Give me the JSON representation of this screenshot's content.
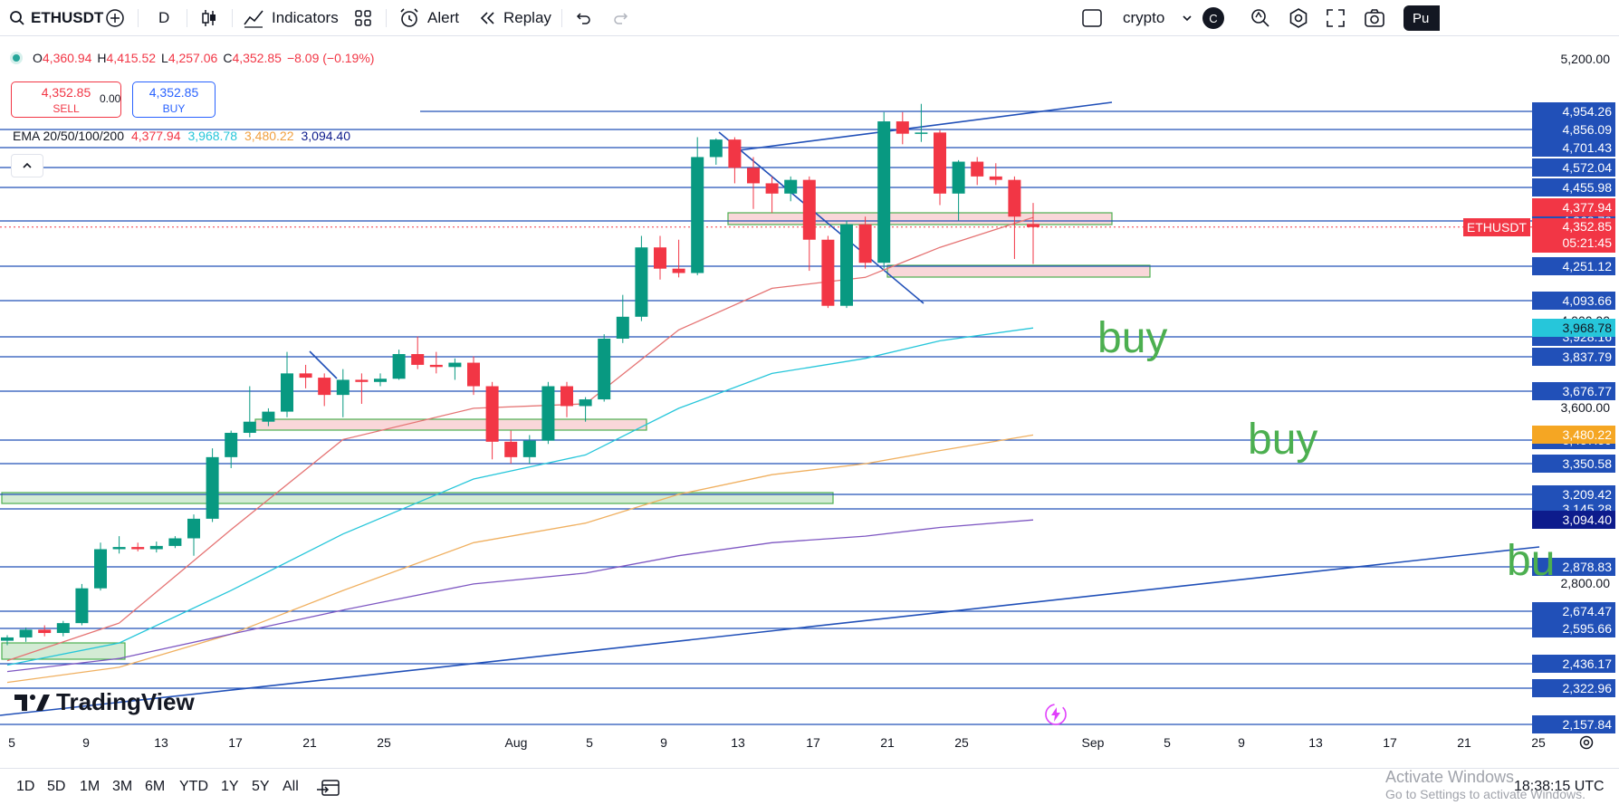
{
  "toolbar": {
    "symbol": "ETHUSDT",
    "interval": "D",
    "indicators_label": "Indicators",
    "alert_label": "Alert",
    "replay_label": "Replay",
    "layout_name": "crypto",
    "avatar_letter": "C",
    "publish_label": "Pu"
  },
  "legend": {
    "open_label": "O",
    "open": "4,360.94",
    "high_label": "H",
    "high": "4,415.52",
    "low_label": "L",
    "low": "4,257.06",
    "close_label": "C",
    "close": "4,352.85",
    "change": "−8.09 (−0.19%)"
  },
  "trade": {
    "sell_price": "4,352.85",
    "sell_label": "SELL",
    "spread": "0.00",
    "buy_price": "4,352.85",
    "buy_label": "BUY"
  },
  "ema": {
    "title": "EMA 20/50/100/200",
    "v20": "4,377.94",
    "v50": "3,968.78",
    "v100": "3,480.22",
    "v200": "3,094.40",
    "colors": {
      "ema20": "#e57373",
      "ema50": "#26c6da",
      "ema100": "#f0b060",
      "ema200": "#7e57c2"
    }
  },
  "price_axis": {
    "ticks": [
      "5,200.00",
      "4,000.00",
      "3,600.00",
      "2,800.00"
    ],
    "levels": [
      "4,954.26",
      "4,856.09",
      "4,701.43",
      "4,572.04",
      "4,455.98",
      "4,368.79",
      "4,251.12",
      "4,093.66",
      "3,928.16",
      "3,837.79",
      "3,676.77",
      "3,457.59",
      "3,350.58",
      "3,209.42",
      "3,145.28",
      "2,878.83",
      "2,674.47",
      "2,595.66",
      "2,436.17",
      "2,322.96",
      "2,157.84"
    ],
    "ema20_label": "4,377.94",
    "ema50_label": "3,968.78",
    "ema100_label": "3,480.22",
    "ema200_label": "3,094.40",
    "symbol_tag": "ETHUSDT",
    "last_price": "4,352.85",
    "countdown": "05:21:45"
  },
  "time_axis": {
    "ticks": [
      "5",
      "9",
      "13",
      "17",
      "21",
      "25",
      "Aug",
      "5",
      "9",
      "13",
      "17",
      "21",
      "25",
      "Sep",
      "5",
      "9",
      "13",
      "17",
      "21",
      "25"
    ]
  },
  "annotations": {
    "buy1": "buy",
    "buy2": "buy",
    "buy3": "bu"
  },
  "branding": {
    "logo": "TradingView"
  },
  "bottombar": {
    "ranges": [
      "1D",
      "5D",
      "1M",
      "3M",
      "6M",
      "YTD",
      "1Y",
      "5Y",
      "All"
    ],
    "clock": "18:38:15 UTC"
  },
  "watermark": {
    "line1": "Activate Windows",
    "line2": "Go to Settings to activate Windows."
  },
  "chart_data": {
    "type": "candlestick",
    "title": "",
    "symbol": "ETHUSDT",
    "interval": "D",
    "ylim": [
      2100,
      5300
    ],
    "x_ticks": [
      "5",
      "9",
      "13",
      "17",
      "21",
      "25",
      "Aug",
      "5",
      "9",
      "13",
      "17",
      "21",
      "25",
      "Sep",
      "5",
      "9",
      "13",
      "17",
      "21",
      "25"
    ],
    "candles": [
      {
        "o": 2540,
        "h": 2565,
        "l": 2520,
        "c": 2555
      },
      {
        "o": 2555,
        "h": 2600,
        "l": 2535,
        "c": 2590
      },
      {
        "o": 2590,
        "h": 2610,
        "l": 2560,
        "c": 2575
      },
      {
        "o": 2575,
        "h": 2630,
        "l": 2560,
        "c": 2620
      },
      {
        "o": 2620,
        "h": 2800,
        "l": 2610,
        "c": 2780
      },
      {
        "o": 2780,
        "h": 2990,
        "l": 2770,
        "c": 2960
      },
      {
        "o": 2960,
        "h": 3020,
        "l": 2940,
        "c": 2970
      },
      {
        "o": 2970,
        "h": 2990,
        "l": 2950,
        "c": 2960
      },
      {
        "o": 2960,
        "h": 2995,
        "l": 2945,
        "c": 2975
      },
      {
        "o": 2975,
        "h": 3020,
        "l": 2965,
        "c": 3010
      },
      {
        "o": 3010,
        "h": 3120,
        "l": 2930,
        "c": 3100
      },
      {
        "o": 3100,
        "h": 3420,
        "l": 3085,
        "c": 3380
      },
      {
        "o": 3380,
        "h": 3500,
        "l": 3330,
        "c": 3490
      },
      {
        "o": 3490,
        "h": 3700,
        "l": 3470,
        "c": 3540
      },
      {
        "o": 3540,
        "h": 3600,
        "l": 3520,
        "c": 3585
      },
      {
        "o": 3585,
        "h": 3860,
        "l": 3560,
        "c": 3760
      },
      {
        "o": 3760,
        "h": 3800,
        "l": 3690,
        "c": 3740
      },
      {
        "o": 3740,
        "h": 3760,
        "l": 3610,
        "c": 3660
      },
      {
        "o": 3660,
        "h": 3780,
        "l": 3560,
        "c": 3730
      },
      {
        "o": 3730,
        "h": 3760,
        "l": 3620,
        "c": 3720
      },
      {
        "o": 3720,
        "h": 3760,
        "l": 3700,
        "c": 3735
      },
      {
        "o": 3735,
        "h": 3870,
        "l": 3730,
        "c": 3850
      },
      {
        "o": 3850,
        "h": 3930,
        "l": 3780,
        "c": 3800
      },
      {
        "o": 3800,
        "h": 3860,
        "l": 3760,
        "c": 3790
      },
      {
        "o": 3790,
        "h": 3830,
        "l": 3730,
        "c": 3810
      },
      {
        "o": 3810,
        "h": 3840,
        "l": 3660,
        "c": 3700
      },
      {
        "o": 3700,
        "h": 3720,
        "l": 3370,
        "c": 3450
      },
      {
        "o": 3450,
        "h": 3500,
        "l": 3350,
        "c": 3380
      },
      {
        "o": 3380,
        "h": 3480,
        "l": 3350,
        "c": 3455
      },
      {
        "o": 3455,
        "h": 3720,
        "l": 3440,
        "c": 3700
      },
      {
        "o": 3700,
        "h": 3720,
        "l": 3560,
        "c": 3610
      },
      {
        "o": 3610,
        "h": 3650,
        "l": 3540,
        "c": 3640
      },
      {
        "o": 3640,
        "h": 3940,
        "l": 3630,
        "c": 3920
      },
      {
        "o": 3920,
        "h": 4120,
        "l": 3900,
        "c": 4020
      },
      {
        "o": 4020,
        "h": 4330,
        "l": 4000,
        "c": 4300
      },
      {
        "o": 4300,
        "h": 4330,
        "l": 4190,
        "c": 4240
      },
      {
        "o": 4240,
        "h": 4320,
        "l": 4200,
        "c": 4220
      },
      {
        "o": 4220,
        "h": 4790,
        "l": 4210,
        "c": 4640
      },
      {
        "o": 4640,
        "h": 4780,
        "l": 4590,
        "c": 4770
      },
      {
        "o": 4770,
        "h": 4790,
        "l": 4480,
        "c": 4570
      },
      {
        "o": 4570,
        "h": 4640,
        "l": 4400,
        "c": 4480
      },
      {
        "o": 4480,
        "h": 4520,
        "l": 4390,
        "c": 4440
      },
      {
        "o": 4440,
        "h": 4520,
        "l": 4420,
        "c": 4500
      },
      {
        "o": 4500,
        "h": 4520,
        "l": 4230,
        "c": 4320
      },
      {
        "o": 4320,
        "h": 4330,
        "l": 4060,
        "c": 4070
      },
      {
        "o": 4070,
        "h": 4370,
        "l": 4060,
        "c": 4360
      },
      {
        "o": 4360,
        "h": 4380,
        "l": 4240,
        "c": 4260
      },
      {
        "o": 4260,
        "h": 4950,
        "l": 4240,
        "c": 4900
      },
      {
        "o": 4900,
        "h": 4950,
        "l": 4730,
        "c": 4820
      },
      {
        "o": 4820,
        "h": 4990,
        "l": 4750,
        "c": 4830
      },
      {
        "o": 4830,
        "h": 4850,
        "l": 4410,
        "c": 4440
      },
      {
        "o": 4440,
        "h": 4620,
        "l": 4370,
        "c": 4610
      },
      {
        "o": 4610,
        "h": 4640,
        "l": 4470,
        "c": 4520
      },
      {
        "o": 4520,
        "h": 4600,
        "l": 4470,
        "c": 4500
      },
      {
        "o": 4500,
        "h": 4520,
        "l": 4270,
        "c": 4380
      },
      {
        "o": 4360.94,
        "h": 4415.52,
        "l": 4257.06,
        "c": 4352.85
      }
    ],
    "ema": {
      "ema20": [
        [
          0,
          2450
        ],
        [
          6,
          2620
        ],
        [
          12,
          3050
        ],
        [
          18,
          3460
        ],
        [
          25,
          3600
        ],
        [
          31,
          3620
        ],
        [
          36,
          3960
        ],
        [
          41,
          4150
        ],
        [
          46,
          4200
        ],
        [
          50,
          4300
        ],
        [
          55,
          4377.94
        ]
      ],
      "ema50": [
        [
          0,
          2430
        ],
        [
          6,
          2530
        ],
        [
          12,
          2770
        ],
        [
          18,
          3030
        ],
        [
          25,
          3280
        ],
        [
          31,
          3390
        ],
        [
          36,
          3600
        ],
        [
          41,
          3760
        ],
        [
          46,
          3830
        ],
        [
          50,
          3910
        ],
        [
          55,
          3968.78
        ]
      ],
      "ema100": [
        [
          0,
          2350
        ],
        [
          6,
          2420
        ],
        [
          12,
          2570
        ],
        [
          18,
          2770
        ],
        [
          25,
          2990
        ],
        [
          31,
          3080
        ],
        [
          36,
          3210
        ],
        [
          41,
          3300
        ],
        [
          46,
          3350
        ],
        [
          50,
          3410
        ],
        [
          55,
          3480.22
        ]
      ],
      "ema200": [
        [
          0,
          2400
        ],
        [
          6,
          2460
        ],
        [
          12,
          2570
        ],
        [
          18,
          2680
        ],
        [
          25,
          2800
        ],
        [
          31,
          2850
        ],
        [
          36,
          2930
        ],
        [
          41,
          2990
        ],
        [
          46,
          3020
        ],
        [
          50,
          3060
        ],
        [
          55,
          3094.4
        ]
      ]
    },
    "levels": [
      4954.26,
      4856.09,
      4701.43,
      4572.04,
      4455.98,
      4368.79,
      4251.12,
      4093.66,
      3928.16,
      3837.79,
      3676.77,
      3457.59,
      3350.58,
      3209.42,
      3145.28,
      2878.83,
      2674.47,
      2595.66,
      2436.17,
      2322.96,
      2157.84
    ],
    "last_price": 4352.85
  }
}
